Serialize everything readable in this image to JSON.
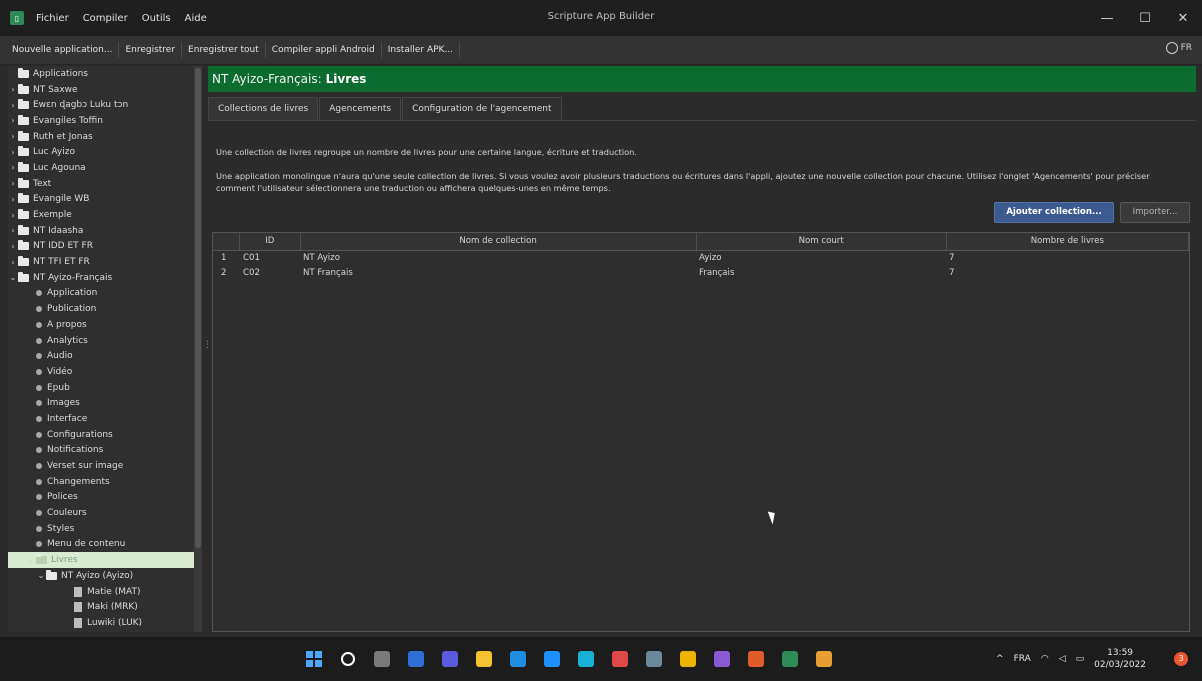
{
  "window": {
    "title": "Scripture App Builder",
    "menus": [
      "Fichier",
      "Compiler",
      "Outils",
      "Aide"
    ],
    "controls": {
      "minimize": "—",
      "maximize": "☐",
      "close": "✕"
    }
  },
  "toolbar": {
    "buttons": [
      "Nouvelle application...",
      "Enregistrer",
      "Enregistrer tout",
      "Compiler appli Android",
      "Installer APK..."
    ],
    "language": "FR"
  },
  "sidebar": {
    "root": "Applications",
    "items": [
      {
        "label": "NT Saxwe",
        "type": "folder"
      },
      {
        "label": "Ewɛn ɖagbɔ Luku tɔn",
        "type": "folder"
      },
      {
        "label": "Evangiles Toffin",
        "type": "folder"
      },
      {
        "label": "Ruth et Jonas",
        "type": "folder"
      },
      {
        "label": "Luc Ayizo",
        "type": "folder"
      },
      {
        "label": "Luc Agouna",
        "type": "folder"
      },
      {
        "label": "Text",
        "type": "folder"
      },
      {
        "label": "Evangile WB",
        "type": "folder"
      },
      {
        "label": "Exemple",
        "type": "folder"
      },
      {
        "label": "NT Idaasha",
        "type": "folder"
      },
      {
        "label": "NT IDD ET FR",
        "type": "folder"
      },
      {
        "label": "NT TFI ET FR",
        "type": "folder"
      },
      {
        "label": "NT Ayizo-Français",
        "type": "folder-open"
      }
    ],
    "sub_items": [
      "Application",
      "Publication",
      "A propos",
      "Analytics",
      "Audio",
      "Vidéo",
      "Epub",
      "Images",
      "Interface",
      "Configurations",
      "Notifications",
      "Verset sur image",
      "Changements",
      "Polices",
      "Couleurs",
      "Styles",
      "Menu de contenu"
    ],
    "selected": "Livres",
    "collection": "NT Ayizo (Ayizo)",
    "books": [
      "Matie (MAT)",
      "Maki (MRK)",
      "Luwiki (LUK)"
    ]
  },
  "panel": {
    "header_prefix": "NT Ayizo-Français:",
    "header_title": "Livres",
    "tabs": [
      "Collections de livres",
      "Agencements",
      "Configuration de l'agencement"
    ],
    "intro_1": "Une collection de livres regroupe un nombre de livres pour une certaine langue, écriture et traduction.",
    "intro_2": "Une application monolingue n'aura qu'une seule collection de livres. Si vous voulez avoir plusieurs traductions ou écritures dans l'appli, ajoutez une nouvelle collection pour chacune. Utilisez l'onglet 'Agencements' pour préciser comment l'utilisateur sélectionnera une traduction ou affichera quelques-unes en même temps.",
    "add_button": "Ajouter collection...",
    "import_button": "Importer..."
  },
  "table": {
    "columns": [
      "",
      "ID",
      "Nom de collection",
      "Nom court",
      "Nombre de livres"
    ],
    "rows": [
      [
        "1",
        "C01",
        "NT Ayizo",
        "Ayizo",
        "7"
      ],
      [
        "2",
        "C02",
        "NT Français",
        "Français",
        "7"
      ]
    ]
  },
  "taskbar": {
    "lang": "FRA",
    "time": "13:59",
    "date": "02/03/2022",
    "notification_count": "3",
    "app_colors": [
      "#4aa8ff",
      "#ffffff",
      "#7a7a7a",
      "#2f6fd6",
      "#5a5ae0",
      "#f2c230",
      "#1e8fe0",
      "#1e90ff",
      "#19b0d6",
      "#e04848",
      "#6a8a9a",
      "#f0b400",
      "#8a5ad6",
      "#e05a2a",
      "#2e8b57",
      "#e8a030"
    ]
  },
  "colors": {
    "header_green": "#0c6b2f",
    "primary_button": "#3b5a8f"
  }
}
